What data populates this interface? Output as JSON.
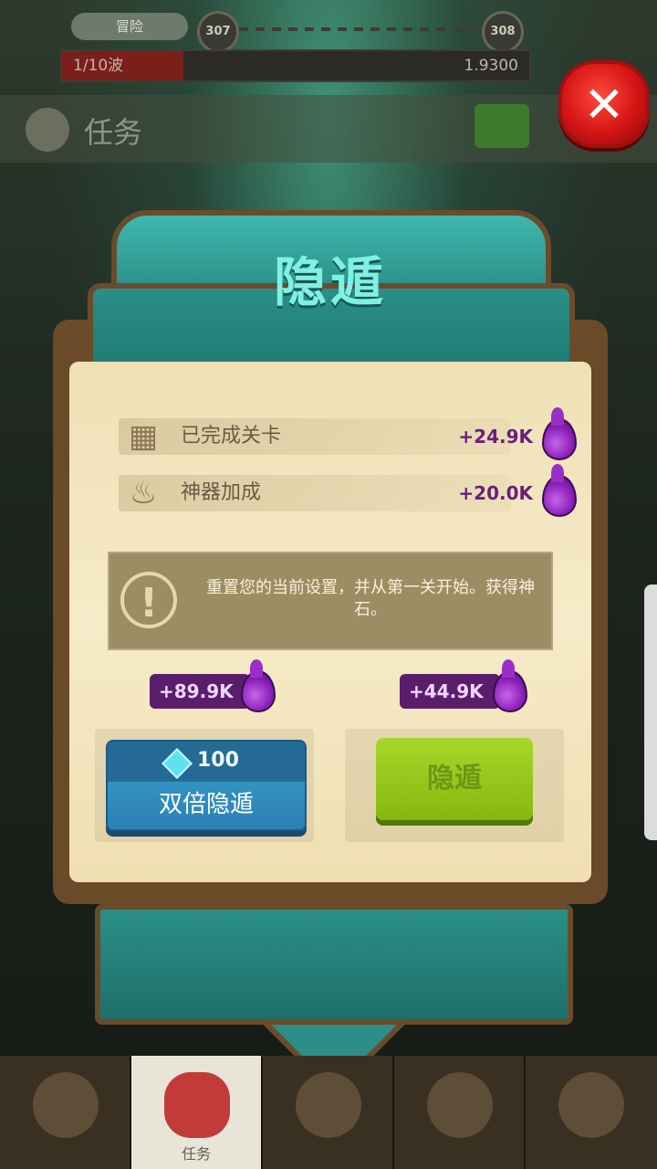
{
  "hud": {
    "mode_label": "冒险",
    "level_current": "307",
    "level_next": "308",
    "wave_label": "1/10波",
    "wave_progress": 0.26,
    "gold": "1.9300"
  },
  "background": {
    "section_title": "任务"
  },
  "modal": {
    "title": "隐遁",
    "bonuses": [
      {
        "label": "已完成关卡",
        "value": "+24.9K",
        "icon": "map-icon"
      },
      {
        "label": "神器加成",
        "value": "+20.0K",
        "icon": "cauldron-icon"
      }
    ],
    "warning": "重置您的当前设置，并从第一关开始。获得神石。",
    "double_reward": "+89.9K",
    "single_reward": "+44.9K",
    "double_button": {
      "cost": "100",
      "label": "双倍隐遁"
    },
    "conceal_button": {
      "label": "隐遁"
    }
  },
  "nav": {
    "items": [
      {
        "label": "",
        "icon": "home-icon"
      },
      {
        "label": "任务",
        "icon": "quest-icon"
      },
      {
        "label": "",
        "icon": "hero-icon"
      },
      {
        "label": "",
        "icon": "artifact-icon"
      },
      {
        "label": "",
        "icon": "chest-icon"
      }
    ]
  },
  "colors": {
    "accent_teal": "#3fb7ad",
    "close_red": "#d41515",
    "reward_purple": "#5a1d6c",
    "button_blue": "#2c7fb3",
    "button_green": "#85b80f"
  }
}
